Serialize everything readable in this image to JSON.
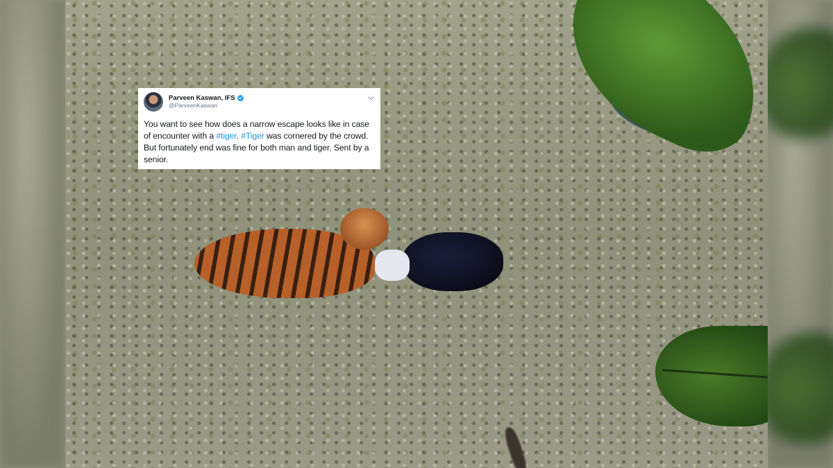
{
  "tweet": {
    "display_name": "Parveen Kaswan, IFS",
    "handle": "@ParveenKaswan",
    "text_part1": "You want to see how does a narrow escape looks like in case of encounter with a ",
    "hashtag1": "#tiger",
    "text_part2": ". ",
    "hashtag2": "#Tiger",
    "text_part3": " was cornered by the crowd. But fortunately end was fine for both man and tiger. Sent by a senior.",
    "link_color": "#1b95e0",
    "verified_color": "#1da1f2",
    "icons": [
      "avatar",
      "verified-icon",
      "chevron-down-icon"
    ]
  }
}
